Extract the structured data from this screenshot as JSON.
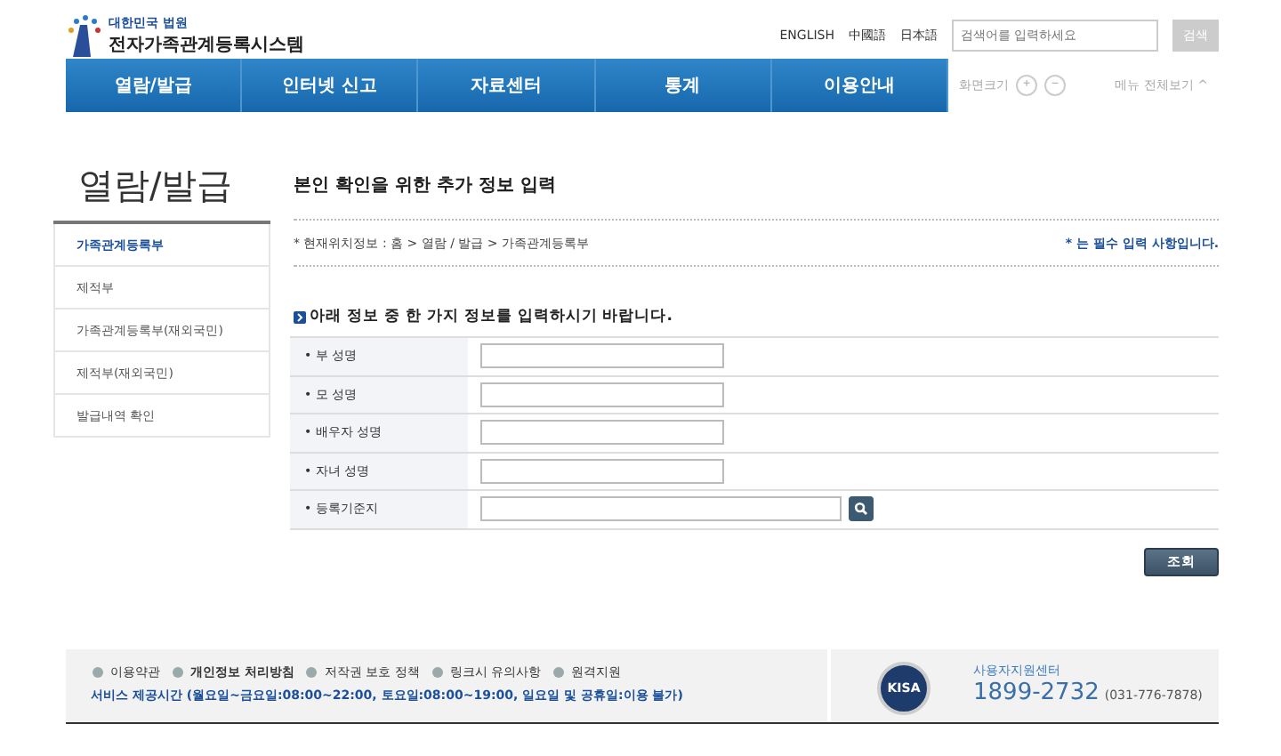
{
  "logo": {
    "small": "대한민국 법원",
    "title": "전자가족관계등록시스템"
  },
  "languages": [
    "ENGLISH",
    "中國語",
    "日本語"
  ],
  "search": {
    "placeholder": "검색어를 입력하세요",
    "button": "검색"
  },
  "nav": [
    "열람/발급",
    "인터넷 신고",
    "자료센터",
    "통계",
    "이용안내"
  ],
  "view_tools": {
    "label": "화면크기",
    "plus": "+",
    "minus": "−",
    "menu": "메뉴 전체보기",
    "caret": "^"
  },
  "sidebar": {
    "title": "열람/발급",
    "items": [
      {
        "label": "가족관계등록부",
        "selected": true
      },
      {
        "label": "제적부",
        "selected": false
      },
      {
        "label": "가족관계등록부(재외국민)",
        "selected": false
      },
      {
        "label": "제적부(재외국민)",
        "selected": false
      },
      {
        "label": "발급내역 확인",
        "selected": false
      }
    ]
  },
  "page_title": "본인 확인을 위한 추가 정보 입력",
  "breadcrumb": "* 현재위치정보 : 홈 > 열람 / 발급 > 가족관계등록부",
  "required_note": "* 는 필수 입력 사항입니다.",
  "form_heading": "아래 정보 중 한 가지 정보를 입력하시기 바랍니다.",
  "fields": [
    {
      "label": "• 부 성명",
      "kind": "text"
    },
    {
      "label": "• 모 성명",
      "kind": "text"
    },
    {
      "label": "• 배우자 성명",
      "kind": "text"
    },
    {
      "label": "• 자녀 성명",
      "kind": "text"
    },
    {
      "label": "• 등록기준지",
      "kind": "search"
    }
  ],
  "submit": "조회",
  "footer": {
    "links": [
      "이용약관",
      "개인정보 처리방침",
      "저작권 보호 정책",
      "링크시 유의사항",
      "원격지원"
    ],
    "hours": "서비스 제공시간 (월요일~금요일:08:00~22:00, 토요일:08:00~19:00, 일요일 및 공휴일:이용 불가)",
    "badge": "KISA",
    "support_label": "사용자지원센터",
    "phone": "1899-2732",
    "phone_alt": "(031-776-7878)"
  }
}
